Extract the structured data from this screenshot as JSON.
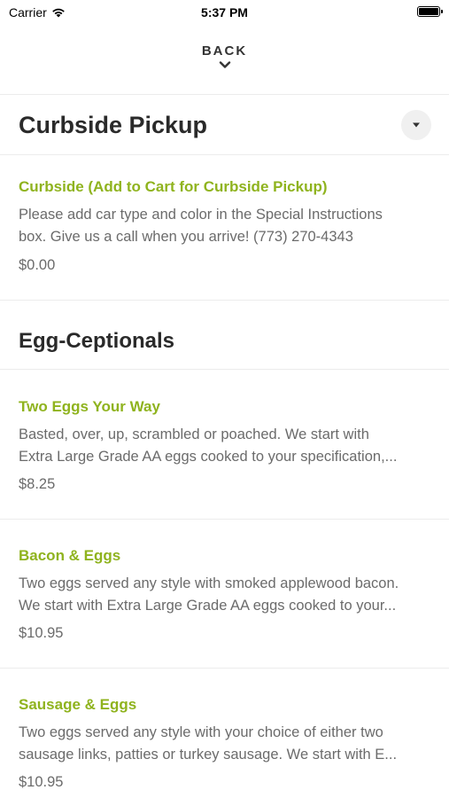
{
  "status_bar": {
    "carrier": "Carrier",
    "time": "5:37 PM",
    "wifi_icon": "wifi-icon",
    "battery_icon": "battery-full-icon"
  },
  "nav": {
    "back_label": "BACK",
    "back_icon": "chevron-down-icon"
  },
  "sections": {
    "curbside": {
      "title": "Curbside Pickup",
      "dropdown_icon": "caret-down-icon",
      "items": [
        {
          "name": "Curbside (Add to Cart for Curbside Pickup)",
          "description_lines": [
            "Please add car type and color in the Special Instructions",
            "box. Give us a call when you arrive! (773) 270-4343"
          ],
          "price": "$0.00"
        }
      ]
    },
    "egg_ceptionals": {
      "title": "Egg-Ceptionals",
      "items": [
        {
          "name": "Two Eggs Your Way",
          "description_lines": [
            "Basted, over, up, scrambled or poached. We start with",
            "Extra Large Grade AA eggs cooked to your specification,..."
          ],
          "price": "$8.25"
        },
        {
          "name": "Bacon & Eggs",
          "description_lines": [
            "Two eggs served any style with smoked applewood bacon.",
            "We start with Extra Large Grade AA eggs cooked to your..."
          ],
          "price": "$10.95"
        },
        {
          "name": "Sausage & Eggs",
          "description_lines": [
            "Two eggs served any style with your choice of either two",
            "sausage links, patties or turkey sausage. We start with E..."
          ],
          "price": "$10.95"
        }
      ]
    }
  },
  "colors": {
    "accent_green": "#8fb31e",
    "body_text": "#6b6b6b",
    "heading_text": "#2a2a2a",
    "divider": "#ececec"
  }
}
